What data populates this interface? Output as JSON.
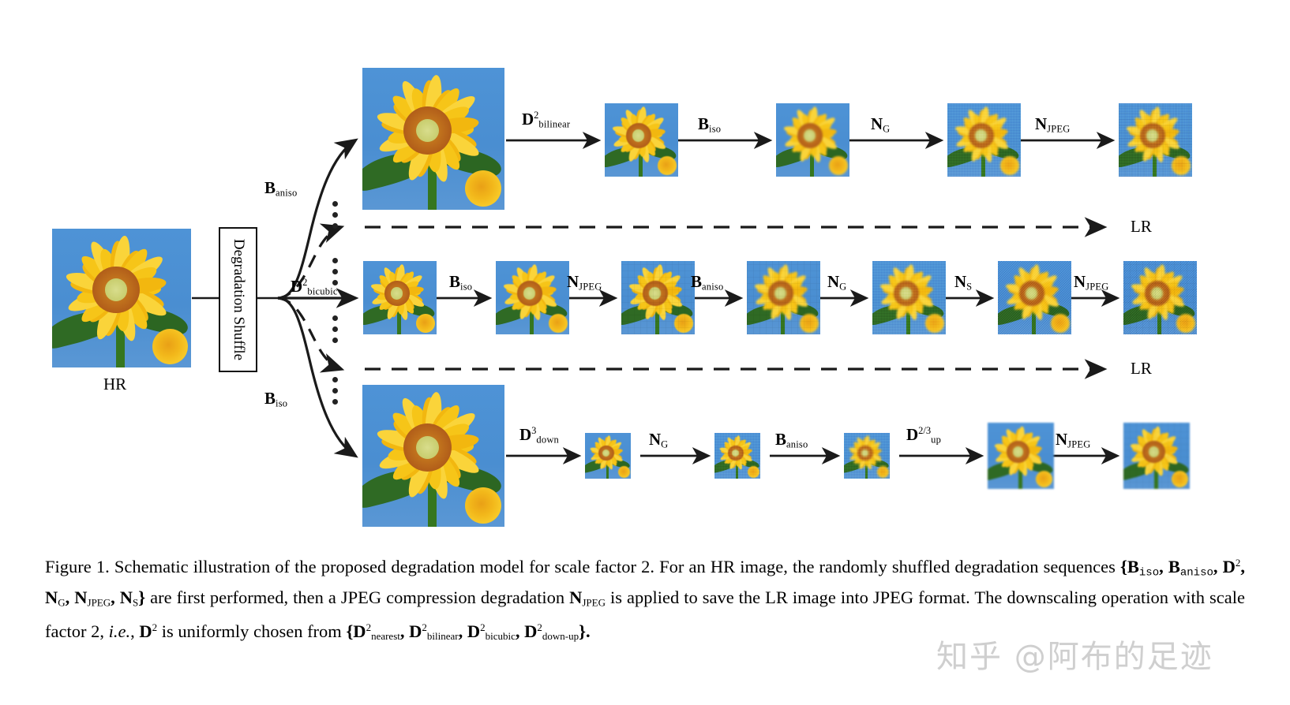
{
  "figure": {
    "id": "figure-1-degradation-model",
    "hr_label": "HR",
    "shuffle_box_label": "Degradation Shuffle",
    "lr_label_top": "LR",
    "lr_label_middle": "LR"
  },
  "branch_labels": {
    "top": {
      "base": "B",
      "sub": "aniso"
    },
    "middle": {
      "base": "D",
      "sup": "2",
      "sub": "bicubic"
    },
    "bottom": {
      "base": "B",
      "sub": "iso"
    }
  },
  "rows": [
    {
      "name": "row-top",
      "ops": [
        {
          "base": "D",
          "sup": "2",
          "sub": "bilinear"
        },
        {
          "base": "B",
          "sub": "iso"
        },
        {
          "base": "N",
          "sub": "G"
        },
        {
          "base": "N",
          "sub": "JPEG"
        }
      ]
    },
    {
      "name": "row-middle",
      "ops": [
        {
          "base": "B",
          "sub": "iso"
        },
        {
          "base": "N",
          "sub": "JPEG"
        },
        {
          "base": "B",
          "sub": "aniso"
        },
        {
          "base": "N",
          "sub": "G"
        },
        {
          "base": "N",
          "sub": "S"
        },
        {
          "base": "N",
          "sub": "JPEG"
        }
      ]
    },
    {
      "name": "row-bottom",
      "ops": [
        {
          "base": "D",
          "sup": "3",
          "sub": "down"
        },
        {
          "base": "N",
          "sub": "G"
        },
        {
          "base": "B",
          "sub": "aniso"
        },
        {
          "base": "D",
          "sup": "2/3",
          "sub": "up"
        },
        {
          "base": "N",
          "sub": "JPEG"
        }
      ]
    }
  ],
  "caption": {
    "seg1": "Figure 1. Schematic illustration of the proposed degradation model for scale factor 2.  For an HR image, the randomly shuffled degradation sequences ",
    "set1": "{B",
    "set1_sub1": "iso",
    "set1_b": ", B",
    "set1_sub2": "aniso",
    "set1_c": ", D",
    "set1_sup": "2",
    "set1_d": ", N",
    "set1_sub3": "G",
    "set1_e": ", N",
    "set1_sub4": "JPEG",
    "set1_f": ", N",
    "set1_sub5": "S",
    "set1_g": "}",
    "seg2": " are first performed, then a JPEG compression degradation ",
    "njpeg": "N",
    "njpeg_sub": "JPEG",
    "seg3": " is applied to save the LR image into JPEG format.  The downscaling operation with scale factor 2, ",
    "ie": "i.e.",
    "seg4": ", ",
    "d2": "D",
    "d2_sup": "2",
    "seg5": " is uniformly chosen from ",
    "set2_open": "{D",
    "set2_sup1": "2",
    "set2_sub1": "nearest",
    "set2_b": ", D",
    "set2_sup2": "2",
    "set2_sub2": "bilinear",
    "set2_c": ", D",
    "set2_sup3": "2",
    "set2_sub3": "bicubic",
    "set2_d": ", D",
    "set2_sup4": "2",
    "set2_sub4": "down-up",
    "set2_close": "}."
  },
  "watermark": {
    "text": "知乎 @阿布的足迹"
  },
  "colors": {
    "sky": "#4a8fd0",
    "petal": "#f6c518",
    "disc": "#c3761e",
    "leaf": "#2f6a24",
    "ink": "#111111",
    "watermark": "#cfcfcf"
  }
}
